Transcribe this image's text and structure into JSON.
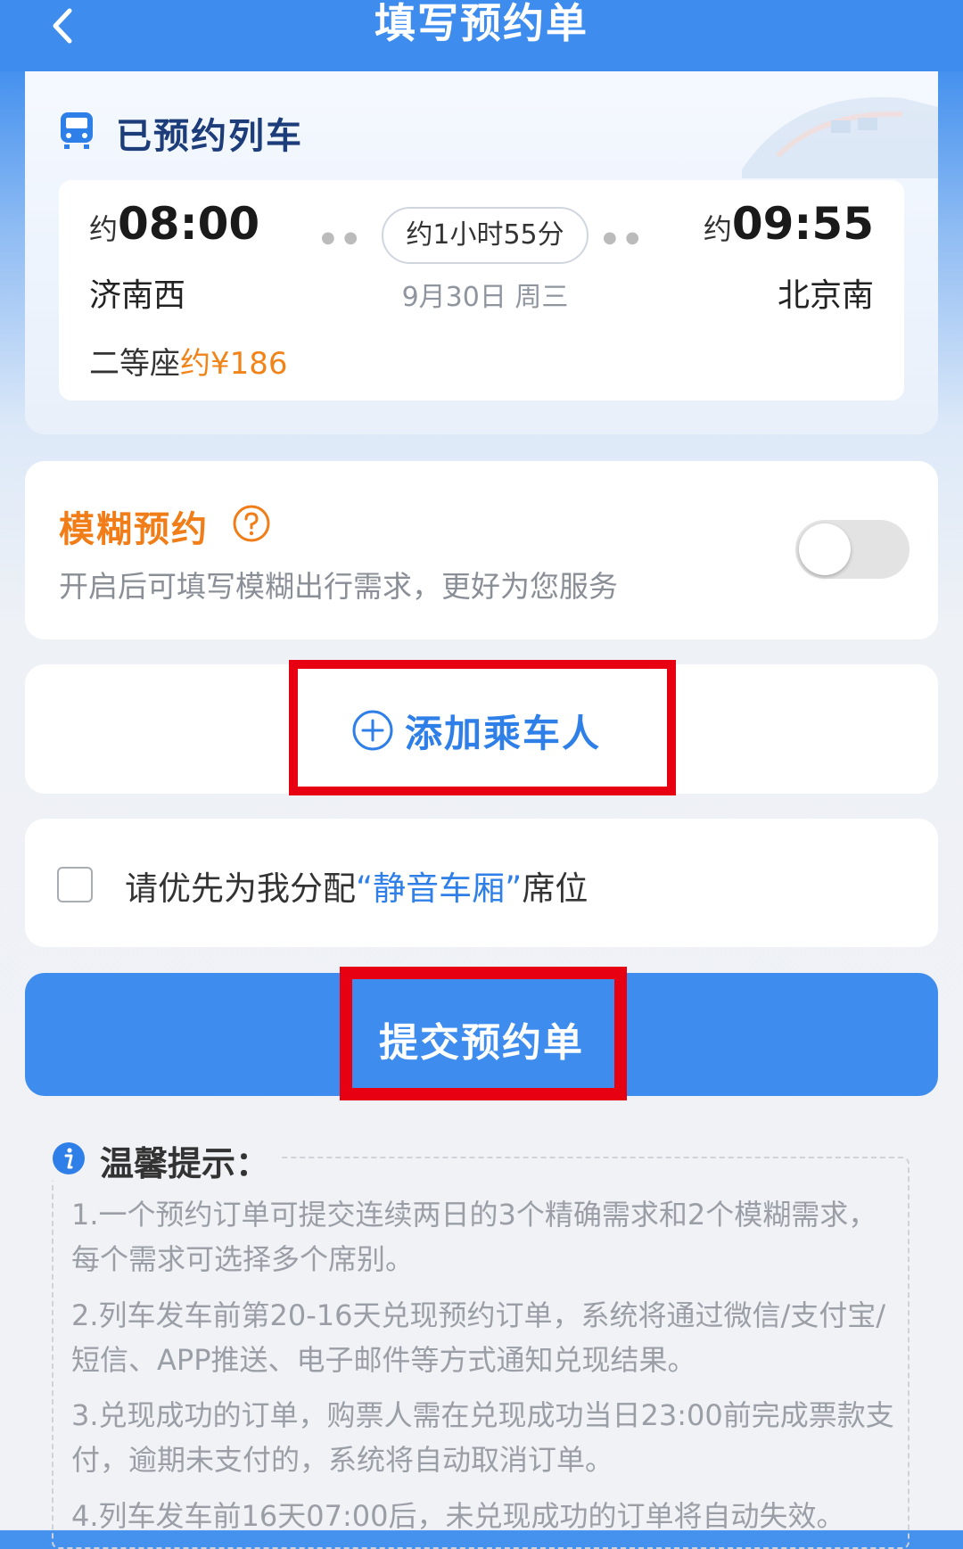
{
  "header": {
    "title": "填写预约单"
  },
  "booked": {
    "title": "已预约列车",
    "approx": "约",
    "departure_time": "08:00",
    "departure_station": "济南西",
    "duration": "约1小时55分",
    "date": "9月30日 周三",
    "arrival_time": "09:55",
    "arrival_station": "北京南",
    "seat_type": "二等座",
    "price": "约¥186"
  },
  "fuzzy": {
    "title": "模糊预约",
    "description": "开启后可填写模糊出行需求，更好为您服务",
    "enabled": false
  },
  "passenger": {
    "add_label": "添加乘车人"
  },
  "quiet_car": {
    "prefix": "请优先为我分配",
    "highlight": "“静音车厢”",
    "suffix": "席位",
    "checked": false
  },
  "submit": {
    "label": "提交预约单"
  },
  "tips": {
    "title": "温馨提示：",
    "items": [
      "1.一个预约订单可提交连续两日的3个精确需求和2个模糊需求，每个需求可选择多个席别。",
      "2.列车发车前第20-16天兑现预约订单，系统将通过微信/支付宝/短信、APP推送、电子邮件等方式通知兑现结果。",
      "3.兑现成功的订单，购票人需在兑现成功当日23:00前完成票款支付，逾期未支付的，系统将自动取消订单。",
      "4.列车发车前16天07:00后，未兑现成功的订单将自动失效。"
    ]
  },
  "colors": {
    "primary": "#3e8cee",
    "accent_orange": "#f07d17",
    "highlight_red": "#e60012"
  }
}
